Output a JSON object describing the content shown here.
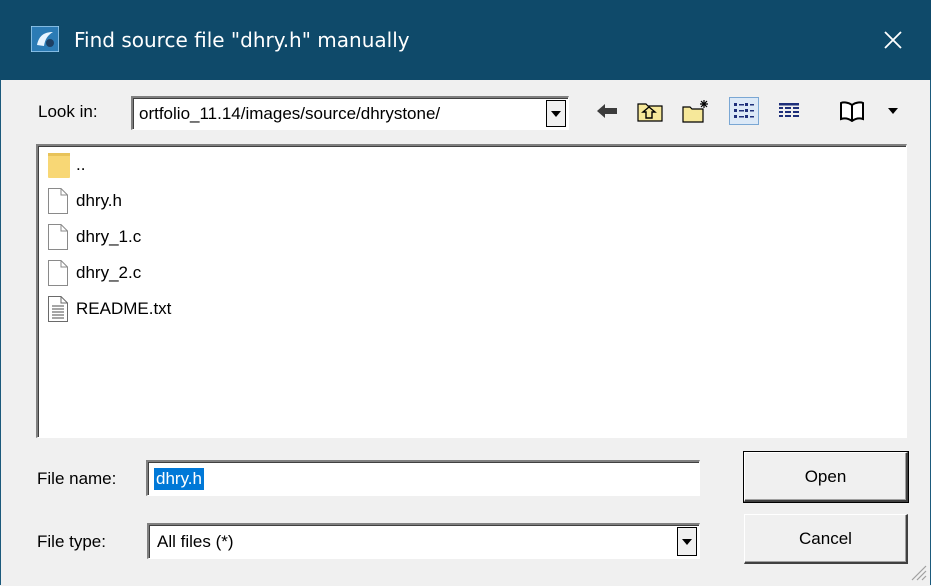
{
  "window": {
    "title": "Find source file \"dhry.h\" manually"
  },
  "look_in": {
    "label": "Look in:",
    "value": "ortfolio_11.14/images/source/dhrystone/"
  },
  "toolbar": {
    "icons": [
      "back-icon",
      "up-folder-icon",
      "new-folder-icon",
      "list-view-icon",
      "details-view-icon",
      "bookmarks-icon",
      "dropdown-arrow-icon"
    ]
  },
  "files": [
    {
      "name": "..",
      "icon": "folder-icon"
    },
    {
      "name": "dhry.h",
      "icon": "file-icon"
    },
    {
      "name": "dhry_1.c",
      "icon": "file-icon"
    },
    {
      "name": "dhry_2.c",
      "icon": "file-icon"
    },
    {
      "name": "README.txt",
      "icon": "text-file-icon"
    }
  ],
  "file_name": {
    "label": "File name:",
    "value": "dhry.h"
  },
  "file_type": {
    "label": "File type:",
    "value": "All files (*)"
  },
  "buttons": {
    "open": "Open",
    "cancel": "Cancel"
  },
  "colors": {
    "titlebar": "#0f4a6a",
    "selection": "#0078d7",
    "folder": "#f8d775"
  }
}
